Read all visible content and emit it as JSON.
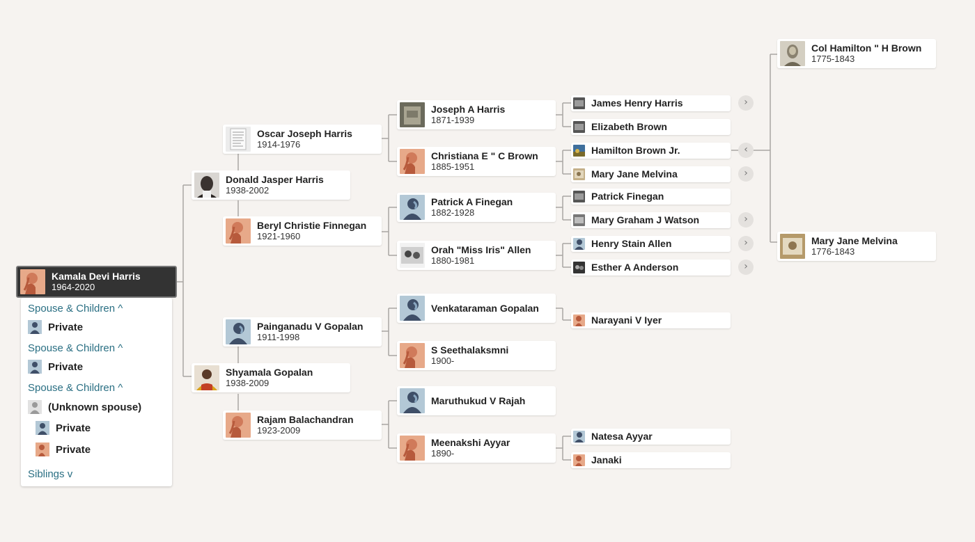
{
  "self": {
    "name": "Kamala Devi Harris",
    "dates": "1964-2020"
  },
  "panel": {
    "spouse_label_1": "Spouse & Children",
    "spouse_1": "Private",
    "spouse_label_2": "Spouse & Children",
    "spouse_2": "Private",
    "spouse_label_3": "Spouse & Children",
    "unknown_spouse": "(Unknown spouse)",
    "child_1": "Private",
    "child_2": "Private",
    "siblings_label": "Siblings"
  },
  "parents": [
    {
      "name": "Donald Jasper Harris",
      "dates": "1938-2002"
    },
    {
      "name": "Shyamala Gopalan",
      "dates": "1938-2009"
    }
  ],
  "grandparents": [
    {
      "name": "Oscar Joseph Harris",
      "dates": "1914-1976"
    },
    {
      "name": "Beryl Christie Finnegan",
      "dates": "1921-1960"
    },
    {
      "name": "Painganadu V Gopalan",
      "dates": "1911-1998"
    },
    {
      "name": "Rajam Balachandran",
      "dates": "1923-2009"
    }
  ],
  "great_grandparents": [
    {
      "name": "Joseph A Harris",
      "dates": "1871-1939"
    },
    {
      "name": "Christiana E \" C Brown",
      "dates": "1885-1951"
    },
    {
      "name": "Patrick A Finegan",
      "dates": "1882-1928"
    },
    {
      "name": "Orah \"Miss Iris\" Allen",
      "dates": "1880-1981"
    },
    {
      "name": "Venkataraman Gopalan",
      "dates": ""
    },
    {
      "name": "S Seethalaksmni",
      "dates": "1900-"
    },
    {
      "name": "Maruthukud V Rajah",
      "dates": ""
    },
    {
      "name": "Meenakshi Ayyar",
      "dates": "1890-"
    }
  ],
  "gen4": [
    {
      "name": "James Henry Harris"
    },
    {
      "name": "Elizabeth Brown"
    },
    {
      "name": "Hamilton Brown Jr."
    },
    {
      "name": "Mary Jane Melvina"
    },
    {
      "name": "Patrick Finegan"
    },
    {
      "name": "Mary Graham J Watson"
    },
    {
      "name": "Henry Stain Allen"
    },
    {
      "name": "Esther A Anderson"
    },
    {
      "name": "Narayani V Iyer"
    },
    {
      "name": "Natesa Ayyar"
    },
    {
      "name": "Janaki"
    }
  ],
  "gen5": [
    {
      "name": "Col Hamilton \" H Brown",
      "dates": "1775-1843"
    },
    {
      "name": "Mary Jane Melvina",
      "dates": "1776-1843"
    }
  ],
  "icons": {
    "expand": "chevron-right-icon",
    "collapse": "chevron-left-icon",
    "toggle_up": "chevron-up-icon",
    "toggle_down": "chevron-down-icon"
  },
  "colors": {
    "background": "#f6f3f0",
    "female_avatar": "#e7a989",
    "male_avatar": "#b3c8d6",
    "link": "#2a6f83",
    "selected_card": "#333333"
  }
}
